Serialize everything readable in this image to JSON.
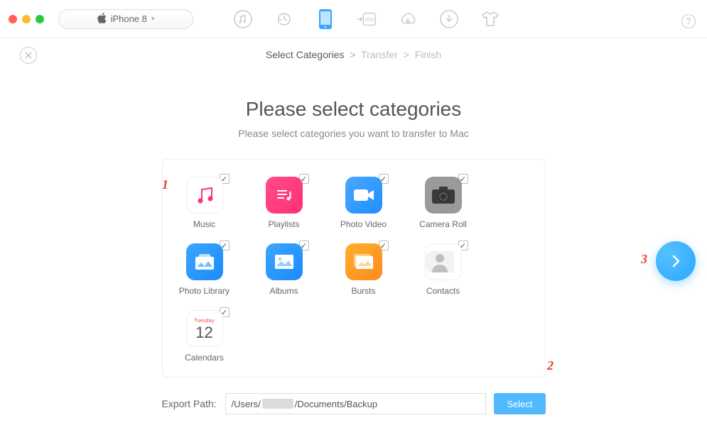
{
  "device": {
    "name": "iPhone 8"
  },
  "breadcrumbs": {
    "step1": "Select Categories",
    "step2": "Transfer",
    "step3": "Finish"
  },
  "heading": {
    "title": "Please select categories",
    "subtitle": "Please select categories you want to transfer to Mac"
  },
  "categories": [
    {
      "key": "music",
      "label": "Music",
      "checked": true
    },
    {
      "key": "playlists",
      "label": "Playlists",
      "checked": true
    },
    {
      "key": "photovideo",
      "label": "Photo Video",
      "checked": true
    },
    {
      "key": "cameraroll",
      "label": "Camera Roll",
      "checked": true
    },
    {
      "key": "photolib",
      "label": "Photo Library",
      "checked": true
    },
    {
      "key": "albums",
      "label": "Albums",
      "checked": true
    },
    {
      "key": "bursts",
      "label": "Bursts",
      "checked": true
    },
    {
      "key": "contacts",
      "label": "Contacts",
      "checked": true
    },
    {
      "key": "calendars",
      "label": "Calendars",
      "checked": true
    }
  ],
  "calendar_tile": {
    "weekday": "Tuesday",
    "day": "12"
  },
  "export": {
    "label": "Export Path:",
    "path_prefix": "/Users/",
    "path_suffix": "/Documents/Backup",
    "select_label": "Select"
  },
  "annotations": {
    "a1": "1",
    "a2": "2",
    "a3": "3"
  },
  "help_glyph": "?"
}
